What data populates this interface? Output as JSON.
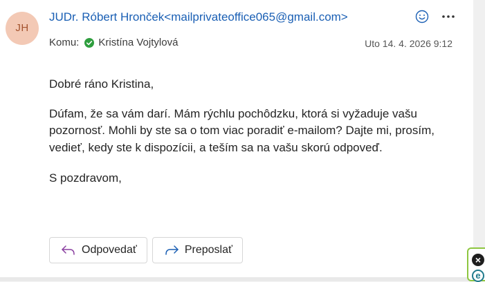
{
  "message": {
    "sender": {
      "initials": "JH",
      "display": "JUDr. Róbert Hronček<mailprivateoffice065@gmail.com>",
      "avatar_color": "#f3c9b5",
      "initials_color": "#a4532e"
    },
    "recipient": {
      "label": "Komu:",
      "name": "Kristína Vojtylová",
      "presence": "available",
      "presence_color": "#2e9e3e"
    },
    "date": "Uto 14. 4. 2026 9:12",
    "header_icons": [
      "emoji-reaction-icon",
      "more-options-icon"
    ],
    "body": {
      "greeting": "Dobré ráno Kristina,",
      "paragraph": "Dúfam, že sa vám darí. Mám rýchlu pochôdzku, ktorá si vyžaduje vašu pozornosť. Mohli by ste sa o tom viac poradiť e-mailom? Dajte mi, prosím, vedieť, kedy ste k dispozícii, a teším sa na vašu skorú odpoveď.",
      "signoff": "S pozdravom,"
    },
    "actions": {
      "reply_label": "Odpovedať",
      "forward_label": "Preposlať",
      "reply_icon": "reply-arrow-icon",
      "forward_icon": "forward-arrow-icon",
      "reply_icon_color": "#8a3fa0",
      "forward_icon_color": "#1a5fb4"
    }
  },
  "extension_widget": {
    "close_icon": "close-icon",
    "logo_letter": "e",
    "border_color": "#8dc63f"
  },
  "colors": {
    "link_blue": "#1a5fb4",
    "text": "#242424"
  }
}
